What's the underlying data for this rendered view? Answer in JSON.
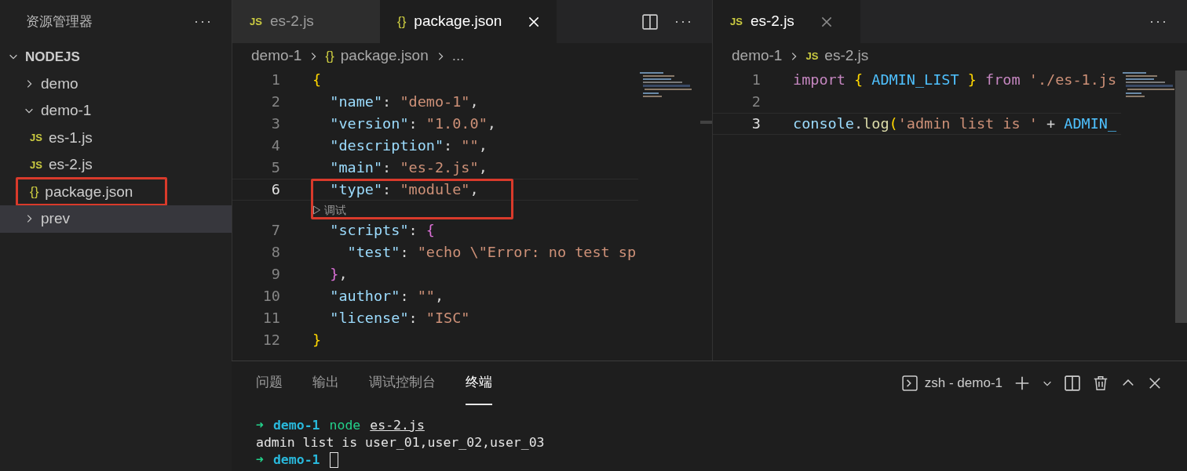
{
  "sidebar": {
    "title": "资源管理器",
    "more": "···",
    "root": {
      "label": "NODEJS",
      "expanded": true,
      "children": [
        {
          "kind": "folder",
          "label": "demo",
          "expanded": false,
          "selected": false,
          "highlighted": false
        },
        {
          "kind": "folder",
          "label": "demo-1",
          "expanded": true,
          "selected": false,
          "highlighted": false,
          "children": [
            {
              "kind": "js",
              "icon": "JS",
              "label": "es-1.js",
              "selected": false,
              "highlighted": false
            },
            {
              "kind": "js",
              "icon": "JS",
              "label": "es-2.js",
              "selected": false,
              "highlighted": false
            },
            {
              "kind": "json",
              "icon": "{}",
              "label": "package.json",
              "selected": false,
              "highlighted": true
            }
          ]
        },
        {
          "kind": "folder",
          "label": "prev",
          "expanded": false,
          "selected": true,
          "highlighted": false
        }
      ]
    }
  },
  "editors": [
    {
      "tabs": [
        {
          "kind": "js",
          "icon": "JS",
          "label": "es-2.js",
          "selected": false,
          "closable": false
        },
        {
          "kind": "json",
          "icon": "{}",
          "label": "package.json",
          "selected": true,
          "closable": true
        }
      ],
      "actions": [
        {
          "kind": "split"
        },
        {
          "kind": "more",
          "label": "···"
        }
      ],
      "breadcrumb": [
        {
          "kind": "text",
          "label": "demo-1"
        },
        {
          "kind": "json",
          "icon": "{}",
          "label": "package.json"
        },
        {
          "kind": "text",
          "label": "..."
        }
      ],
      "rows": [
        {
          "kind": "code",
          "number": "1",
          "current": false,
          "tokens": [
            {
              "kind": "brace",
              "text": "{"
            }
          ]
        },
        {
          "kind": "code",
          "number": "2",
          "current": false,
          "tokens": [
            {
              "kind": "key",
              "text": "  \"name\""
            },
            {
              "kind": "punct",
              "text": ": "
            },
            {
              "kind": "str",
              "text": "\"demo-1\""
            },
            {
              "kind": "punct",
              "text": ","
            }
          ]
        },
        {
          "kind": "code",
          "number": "3",
          "current": false,
          "tokens": [
            {
              "kind": "key",
              "text": "  \"version\""
            },
            {
              "kind": "punct",
              "text": ": "
            },
            {
              "kind": "str",
              "text": "\"1.0.0\""
            },
            {
              "kind": "punct",
              "text": ","
            }
          ]
        },
        {
          "kind": "code",
          "number": "4",
          "current": false,
          "tokens": [
            {
              "kind": "key",
              "text": "  \"description\""
            },
            {
              "kind": "punct",
              "text": ": "
            },
            {
              "kind": "str",
              "text": "\"\""
            },
            {
              "kind": "punct",
              "text": ","
            }
          ]
        },
        {
          "kind": "code",
          "number": "5",
          "current": false,
          "tokens": [
            {
              "kind": "key",
              "text": "  \"main\""
            },
            {
              "kind": "punct",
              "text": ": "
            },
            {
              "kind": "str",
              "text": "\"es-2.js\""
            },
            {
              "kind": "punct",
              "text": ","
            }
          ]
        },
        {
          "kind": "code",
          "number": "6",
          "current": true,
          "highlighted": true,
          "tokens": [
            {
              "kind": "key",
              "text": "  \"type\""
            },
            {
              "kind": "punct",
              "text": ": "
            },
            {
              "kind": "str",
              "text": "\"module\""
            },
            {
              "kind": "punct",
              "text": ","
            }
          ]
        },
        {
          "kind": "lens",
          "label": "调试",
          "highlighted": true
        },
        {
          "kind": "code",
          "number": "7",
          "current": false,
          "tokens": [
            {
              "kind": "key",
              "text": "  \"scripts\""
            },
            {
              "kind": "punct",
              "text": ": "
            },
            {
              "kind": "brace2",
              "text": "{"
            }
          ]
        },
        {
          "kind": "code",
          "number": "8",
          "current": false,
          "tokens": [
            {
              "kind": "key",
              "text": "    \"test\""
            },
            {
              "kind": "punct",
              "text": ": "
            },
            {
              "kind": "str",
              "text": "\"echo \\\"Error: no test sp"
            }
          ]
        },
        {
          "kind": "code",
          "number": "9",
          "current": false,
          "tokens": [
            {
              "kind": "brace2",
              "text": "  }"
            },
            {
              "kind": "punct",
              "text": ","
            }
          ]
        },
        {
          "kind": "code",
          "number": "10",
          "current": false,
          "tokens": [
            {
              "kind": "key",
              "text": "  \"author\""
            },
            {
              "kind": "punct",
              "text": ": "
            },
            {
              "kind": "str",
              "text": "\"\""
            },
            {
              "kind": "punct",
              "text": ","
            }
          ]
        },
        {
          "kind": "code",
          "number": "11",
          "current": false,
          "tokens": [
            {
              "kind": "key",
              "text": "  \"license\""
            },
            {
              "kind": "punct",
              "text": ": "
            },
            {
              "kind": "str",
              "text": "\"ISC\""
            }
          ]
        },
        {
          "kind": "code",
          "number": "12",
          "current": false,
          "tokens": [
            {
              "kind": "brace",
              "text": "}"
            }
          ]
        }
      ]
    },
    {
      "tabs": [
        {
          "kind": "js",
          "icon": "JS",
          "label": "es-2.js",
          "selected": true,
          "closable": true
        }
      ],
      "actions": [
        {
          "kind": "more",
          "label": "···"
        }
      ],
      "breadcrumb": [
        {
          "kind": "text",
          "label": "demo-1"
        },
        {
          "kind": "js",
          "icon": "JS",
          "label": "es-2.js"
        }
      ],
      "rows": [
        {
          "kind": "code",
          "number": "1",
          "current": false,
          "tokens": [
            {
              "kind": "keyword",
              "text": "import "
            },
            {
              "kind": "brace",
              "text": "{ "
            },
            {
              "kind": "var",
              "text": "ADMIN_LIST"
            },
            {
              "kind": "brace",
              "text": " }"
            },
            {
              "kind": "keyword",
              "text": " from "
            },
            {
              "kind": "str",
              "text": "'./es-1.js"
            }
          ]
        },
        {
          "kind": "code",
          "number": "2",
          "current": false,
          "tokens": []
        },
        {
          "kind": "code",
          "number": "3",
          "current": true,
          "tokens": [
            {
              "kind": "ident",
              "text": "console"
            },
            {
              "kind": "punct",
              "text": "."
            },
            {
              "kind": "func",
              "text": "log"
            },
            {
              "kind": "brace",
              "text": "("
            },
            {
              "kind": "str",
              "text": "'admin list is '"
            },
            {
              "kind": "punct",
              "text": " + "
            },
            {
              "kind": "var",
              "text": "ADMIN_"
            }
          ]
        }
      ]
    }
  ],
  "panel": {
    "tabs": [
      {
        "label": "问题",
        "selected": false
      },
      {
        "label": "输出",
        "selected": false
      },
      {
        "label": "调试控制台",
        "selected": false
      },
      {
        "label": "终端",
        "selected": true
      }
    ],
    "terminal_name": "zsh - demo-1",
    "lines": [
      {
        "tokens": [
          {
            "kind": "arrow",
            "text": "➜"
          },
          {
            "kind": "dir",
            "text": "demo-1"
          },
          {
            "kind": "cmd",
            "text": "node"
          },
          {
            "kind": "arg",
            "text": "es-2.js"
          }
        ]
      },
      {
        "tokens": [
          {
            "kind": "out",
            "text": "admin list is user_01,user_02,user_03"
          }
        ]
      },
      {
        "tokens": [
          {
            "kind": "arrow",
            "text": "➜"
          },
          {
            "kind": "dir",
            "text": "demo-1"
          },
          {
            "kind": "cursor"
          }
        ]
      }
    ]
  }
}
